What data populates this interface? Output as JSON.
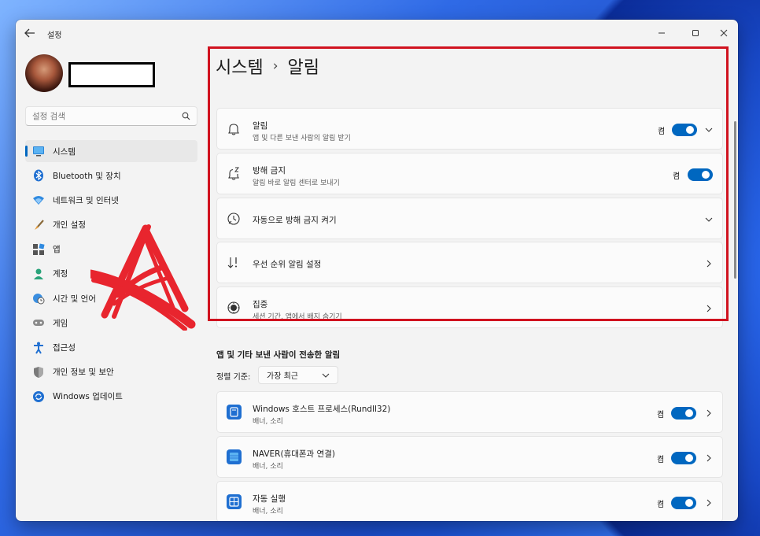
{
  "window": {
    "title": "설정"
  },
  "sidebar": {
    "search_placeholder": "설정 검색",
    "items": [
      {
        "label": "시스템",
        "icon": "monitor-icon",
        "active": true
      },
      {
        "label": "Bluetooth 및 장치",
        "icon": "bluetooth-icon"
      },
      {
        "label": "네트워크 및 인터넷",
        "icon": "wifi-icon"
      },
      {
        "label": "개인 설정",
        "icon": "brush-icon"
      },
      {
        "label": "앱",
        "icon": "apps-icon"
      },
      {
        "label": "계정",
        "icon": "person-icon"
      },
      {
        "label": "시간 및 언어",
        "icon": "globe-clock-icon"
      },
      {
        "label": "게임",
        "icon": "gamepad-icon"
      },
      {
        "label": "접근성",
        "icon": "accessibility-icon"
      },
      {
        "label": "개인 정보 및 보안",
        "icon": "shield-icon"
      },
      {
        "label": "Windows 업데이트",
        "icon": "update-icon"
      }
    ]
  },
  "main": {
    "breadcrumb": {
      "parent": "시스템",
      "separator": "›",
      "current": "알림"
    },
    "settings": [
      {
        "title": "알림",
        "subtitle": "앱 및 다른 보낸 사람의 알림 받기",
        "state": "켬",
        "icon": "bell-icon"
      },
      {
        "title": "방해 금지",
        "subtitle": "알림 바로 알림 센터로 보내기",
        "state": "켬",
        "icon": "bell-snooze-icon"
      },
      {
        "title": "자동으로 방해 금지 켜기",
        "icon": "clock-icon"
      },
      {
        "title": "우선 순위 알림 설정",
        "icon": "sort-priority-icon"
      },
      {
        "title": "집중",
        "subtitle": "세션 기간, 앱에서 배지 숨기기",
        "icon": "focus-icon"
      }
    ],
    "apps_section": {
      "title": "앱 및 기타 보낸 사람이 전송한 알림",
      "sort_label": "정렬 기준:",
      "sort_value": "가장 최근",
      "apps": [
        {
          "title": "Windows 호스트 프로세스(Rundll32)",
          "subtitle": "배너, 소리",
          "state": "켬",
          "icon": "app-window-icon"
        },
        {
          "title": "NAVER(휴대폰과 연결)",
          "subtitle": "배너, 소리",
          "state": "켬",
          "icon": "phone-link-icon"
        },
        {
          "title": "자동 실행",
          "subtitle": "배너, 소리",
          "state": "켬",
          "icon": "autoplay-icon"
        }
      ]
    }
  },
  "colors": {
    "accent": "#0067c0",
    "highlight": "#d0121f",
    "scribble": "#e8141e"
  }
}
